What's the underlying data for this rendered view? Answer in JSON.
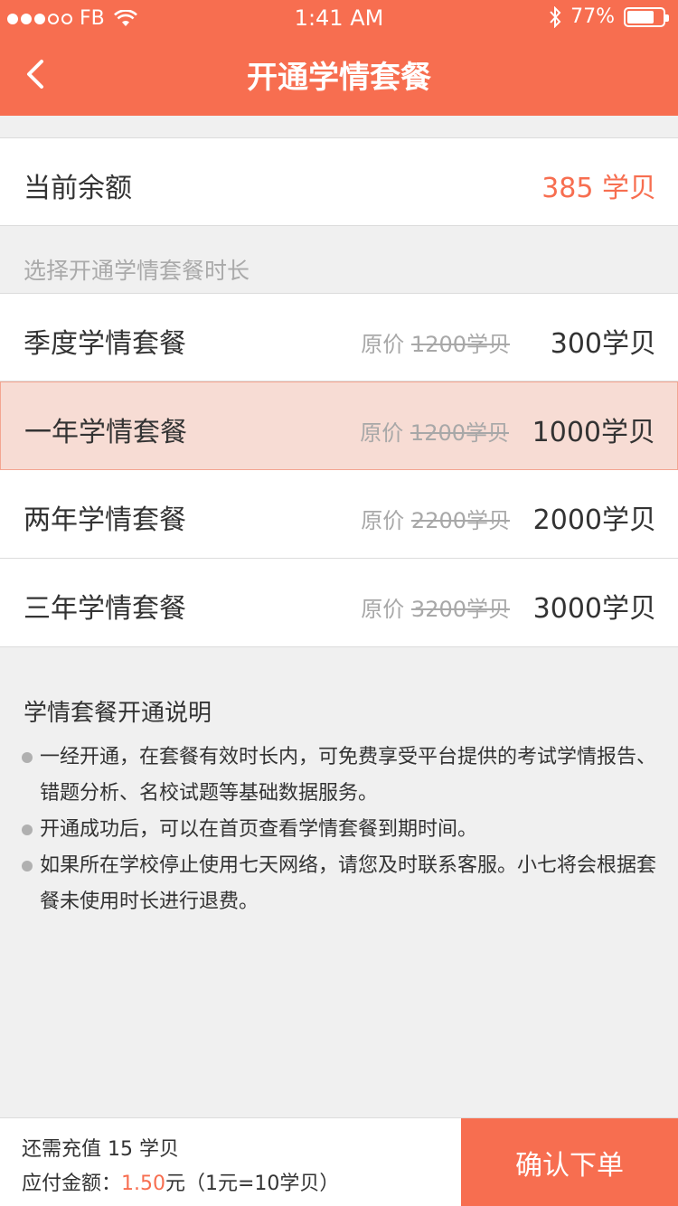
{
  "status_bar": {
    "carrier": "FB",
    "time": "1:41 AM",
    "battery_percent": "77%",
    "battery_level": 0.77,
    "signal_bars_filled": 3,
    "signal_bars_total": 5
  },
  "nav": {
    "title": "开通学情套餐",
    "back_icon": "chevron-left-icon"
  },
  "balance": {
    "label": "当前余额",
    "value": "385 学贝"
  },
  "section_label": "选择开通学情套餐时长",
  "plans": [
    {
      "name": "季度学情套餐",
      "orig_prefix": "原价 ",
      "orig_value": "1200学贝",
      "price": "300学贝",
      "selected": false
    },
    {
      "name": "一年学情套餐",
      "orig_prefix": "原价 ",
      "orig_value": "1200学贝",
      "price": "1000学贝",
      "selected": true
    },
    {
      "name": "两年学情套餐",
      "orig_prefix": "原价 ",
      "orig_value": "2200学贝",
      "price": "2000学贝",
      "selected": false
    },
    {
      "name": "三年学情套餐",
      "orig_prefix": "原价 ",
      "orig_value": "3200学贝",
      "price": "3000学贝",
      "selected": false
    }
  ],
  "notes": {
    "title": "学情套餐开通说明",
    "items": [
      "一经开通，在套餐有效时长内，可免费享受平台提供的考试学情报告、错题分析、名校试题等基础数据服务。",
      "开通成功后，可以在首页查看学情套餐到期时间。",
      "如果所在学校停止使用七天网络，请您及时联系客服。小七将会根据套餐未使用时长进行退费。"
    ]
  },
  "footer": {
    "recharge_text": "还需充值 15 学贝",
    "pay_label": "应付金额：",
    "pay_amount": "1.50",
    "pay_suffix": "元（1元=10学贝）",
    "confirm_label": "确认下单"
  },
  "colors": {
    "accent": "#f76e50",
    "selected_bg": "#f7dcd4",
    "page_bg": "#f0f0f0"
  }
}
